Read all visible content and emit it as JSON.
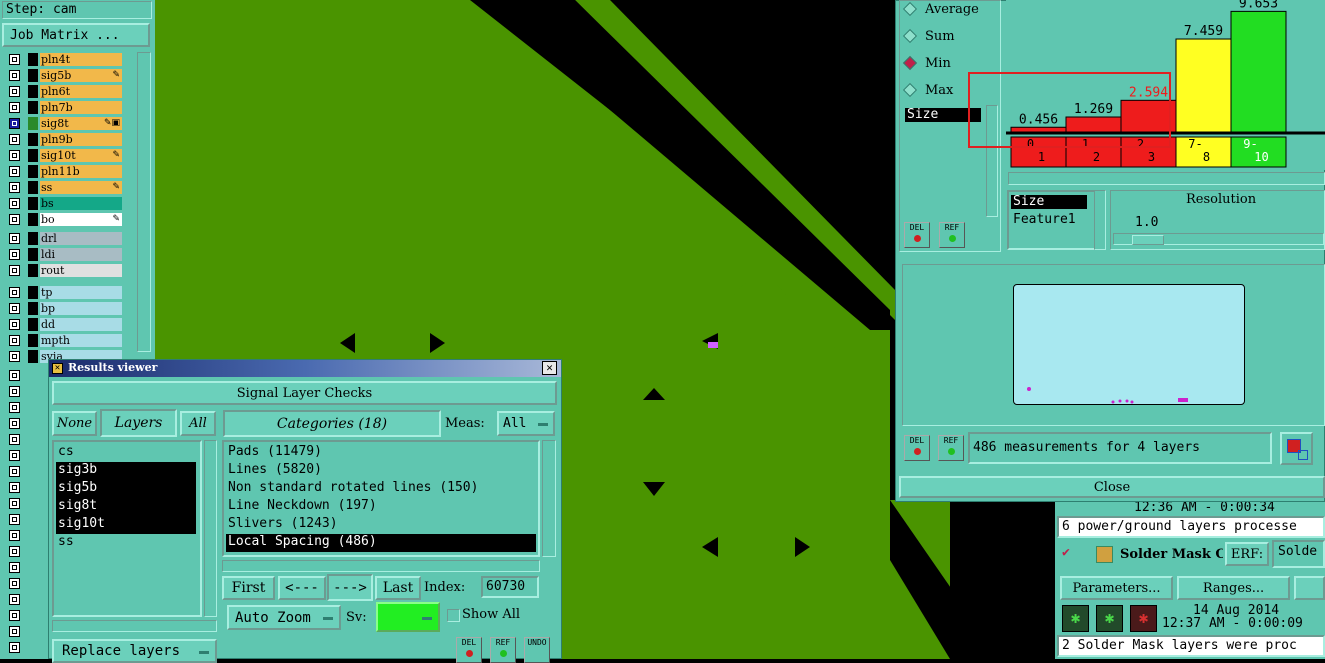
{
  "step": "Step: cam",
  "job_matrix": "Job Matrix ...",
  "layers_group1": [
    {
      "name": "pln4t",
      "color": "#f2b84a",
      "selected": false,
      "editable": false
    },
    {
      "name": "sig5b",
      "color": "#f2b84a",
      "selected": false,
      "editable": true
    },
    {
      "name": "pln6t",
      "color": "#f2b84a",
      "selected": false,
      "editable": false
    },
    {
      "name": "pln7b",
      "color": "#f2b84a",
      "selected": false,
      "editable": false
    },
    {
      "name": "sig8t",
      "color": "#f2b84a",
      "selected": true,
      "editable": true
    },
    {
      "name": "pln9b",
      "color": "#f2b84a",
      "selected": false,
      "editable": false
    },
    {
      "name": "sig10t",
      "color": "#f2b84a",
      "selected": false,
      "editable": true
    },
    {
      "name": "pln11b",
      "color": "#f2b84a",
      "selected": false,
      "editable": false
    },
    {
      "name": "ss",
      "color": "#f2b84a",
      "selected": false,
      "editable": true
    },
    {
      "name": "bs",
      "color": "#14a888",
      "selected": false,
      "editable": false
    },
    {
      "name": "bo",
      "color": "#ffffff",
      "selected": false,
      "editable": true
    }
  ],
  "layers_group2": [
    {
      "name": "drl",
      "color": "#a8bcc4"
    },
    {
      "name": "ldi",
      "color": "#a8bcc4"
    },
    {
      "name": "rout",
      "color": "#e0e0e0"
    }
  ],
  "layers_group3": [
    {
      "name": "tp",
      "color": "#a8dce6"
    },
    {
      "name": "bp",
      "color": "#a8dce6"
    },
    {
      "name": "dd",
      "color": "#a8dce6"
    },
    {
      "name": "mpth",
      "color": "#a8dce6"
    },
    {
      "name": "svia",
      "color": "#a8dce6"
    }
  ],
  "results_viewer": {
    "title": "Results viewer",
    "header": "Signal Layer Checks",
    "none": "None",
    "layers": "Layers",
    "all": "All",
    "categories": "Categories (18)",
    "meas_label": "Meas:",
    "meas_value": "All",
    "layer_list": [
      "cs",
      "sig3b",
      "sig5b",
      "sig8t",
      "sig10t",
      "ss"
    ],
    "layer_selected": [
      false,
      true,
      true,
      true,
      true,
      false
    ],
    "category_list": [
      "Pads (11479)",
      "Lines (5820)",
      "Non standard rotated lines (150)",
      "Line Neckdown (197)",
      "Slivers (1243)",
      "Local Spacing (486)"
    ],
    "category_selected": 5,
    "first": "First",
    "prev": "<---",
    "next": "--->",
    "last": "Last",
    "index_label": "Index:",
    "index_value": "60730",
    "auto_zoom": "Auto Zoom",
    "sv_label": "Sv:",
    "show_all": "Show All",
    "replace_layers": "Replace layers",
    "del": "DEL",
    "ref": "REF",
    "undo": "UNDO"
  },
  "stats": {
    "options": [
      "Average",
      "Sum",
      "Min",
      "Max"
    ],
    "selected": "Min",
    "size_label": "Size",
    "size_list": [
      "Size",
      "Feature1"
    ],
    "resolution_label": "Resolution",
    "resolution_value": "1.0",
    "measurements": "486 measurements for 4 layers",
    "close": "Close",
    "del": "DEL",
    "ref": "REF"
  },
  "chart_data": {
    "type": "bar",
    "categories": [
      "0-1",
      "1-2",
      "2-3",
      "7-8",
      "9-10"
    ],
    "values": [
      0.456,
      1.269,
      2.594,
      7.459,
      9.653
    ],
    "value_labels": [
      "0.456",
      "1.269",
      "2.594",
      "7.459",
      "9.653"
    ],
    "bin_top": [
      "0",
      "1",
      "2",
      "7-",
      "9-"
    ],
    "bin_bottom": [
      "1",
      "2",
      "3",
      "8",
      "10"
    ],
    "colors": [
      "#ee1c1c",
      "#ee1c1c",
      "#ee1c1c",
      "#ffff22",
      "#22dd22"
    ],
    "label_colors": [
      "#000000",
      "#000000",
      "#ee1c1c",
      "#000000",
      "#000000"
    ],
    "bin_text_colors": [
      "#000000",
      "#000000",
      "#000000",
      "#000000",
      "#ffffff"
    ],
    "highlighted_bins": [
      0,
      1,
      2
    ],
    "ylim": [
      0,
      10
    ]
  },
  "bottom_right": {
    "time1": "12:36 AM - 0:00:34",
    "msg1": "6 power/ground layers processe",
    "solder_mask": "Solder Mask Ch",
    "erf_label": "ERF:",
    "erf_value": "Solde",
    "parameters": "Parameters...",
    "ranges": "Ranges...",
    "date": "14 Aug 2014",
    "time2": "12:37 AM - 0:00:09",
    "msg2": "2 Solder Mask layers were proc"
  },
  "colors": {
    "board_green": "#4a9400",
    "panel_teal": "#5fc6b0",
    "selection": "#000000"
  }
}
